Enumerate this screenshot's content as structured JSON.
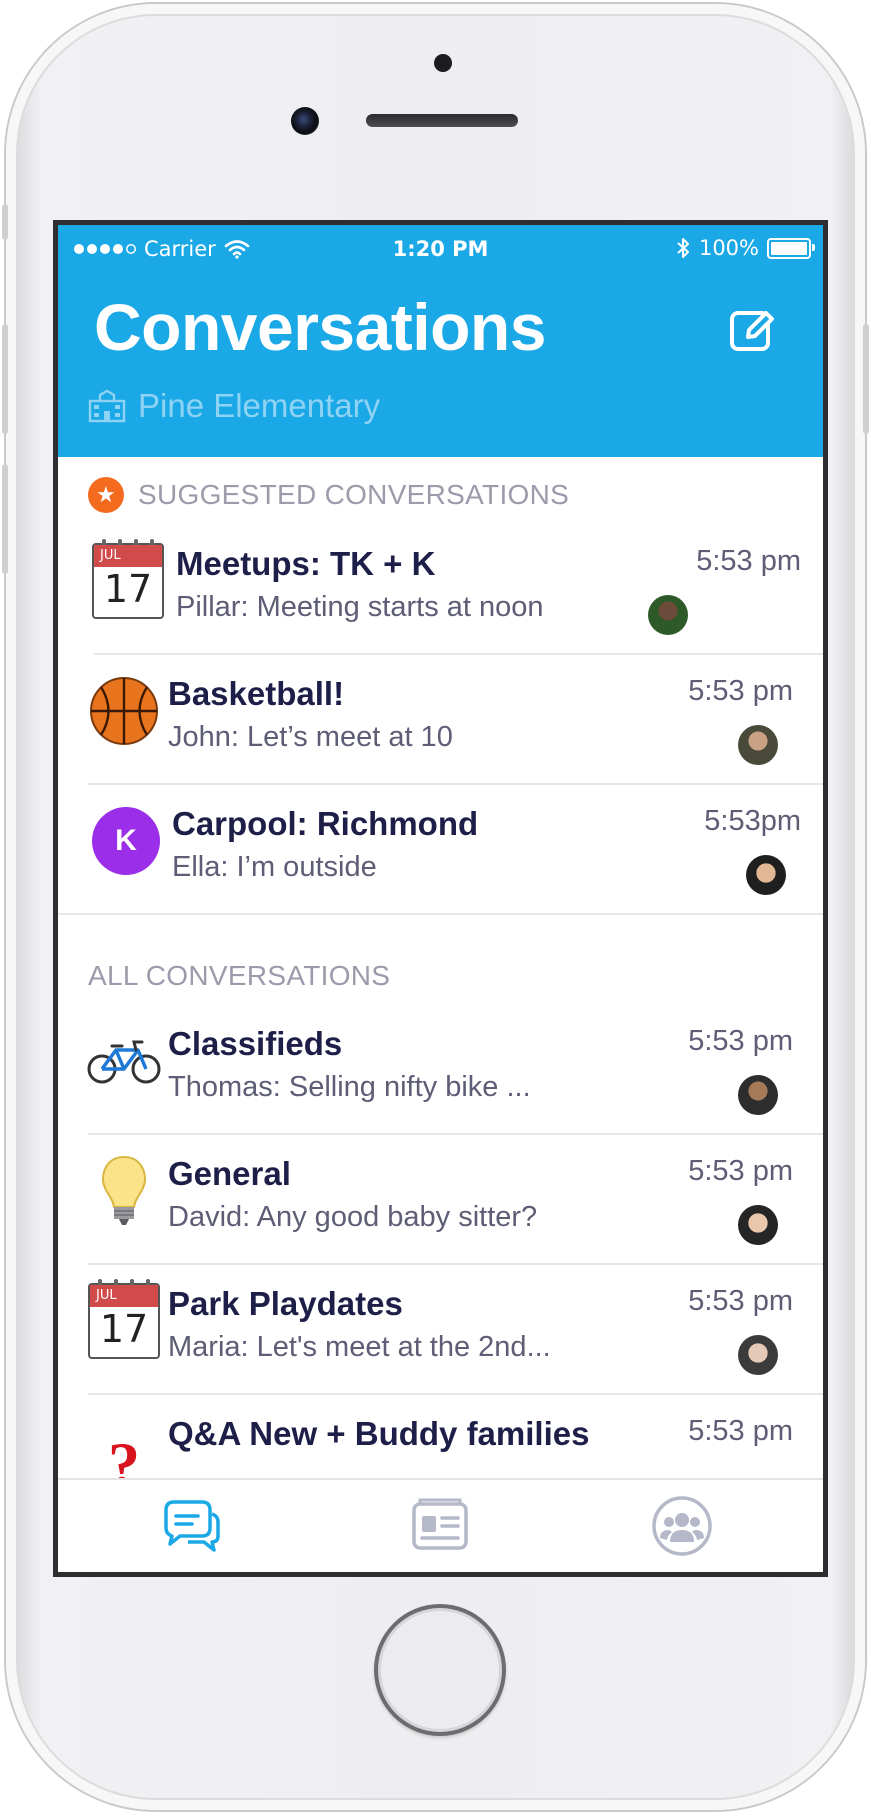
{
  "status_bar": {
    "carrier": "Carrier",
    "time": "1:20 PM",
    "battery": "100%"
  },
  "header": {
    "title": "Conversations",
    "school": "Pine Elementary",
    "colors": {
      "brand": "#1ba8e6",
      "school_text": "#8fd3f4"
    }
  },
  "suggested": {
    "heading": "SUGGESTED CONVERSATIONS",
    "items": [
      {
        "name": "Meetups: TK + K",
        "message": "Pillar: Meeting starts at noon",
        "time": "5:53 pm",
        "icon": "calendar-icon",
        "calendar_month": "JUL",
        "calendar_day": "17"
      },
      {
        "name": "Basketball!",
        "message": "John: Let’s meet at 10",
        "time": "5:53 pm",
        "icon": "basketball-icon"
      },
      {
        "name": "Carpool: Richmond",
        "message": "Ella: I’m outside",
        "time": "5:53pm",
        "icon": "letter-badge",
        "badge_letter": "K"
      }
    ]
  },
  "all": {
    "heading": "ALL CONVERSATIONS",
    "items": [
      {
        "name": "Classifieds",
        "message": "Thomas: Selling nifty bike ...",
        "time": "5:53 pm",
        "icon": "bicycle-icon"
      },
      {
        "name": "General",
        "message": "David: Any good baby sitter?",
        "time": "5:53 pm",
        "icon": "lightbulb-icon"
      },
      {
        "name": "Park Playdates",
        "message": "Maria: Let's meet at the 2nd...",
        "time": "5:53 pm",
        "icon": "calendar-icon",
        "calendar_month": "JUL",
        "calendar_day": "17"
      },
      {
        "name": "Q&A New + Buddy families",
        "message": "",
        "time": "5:53 pm",
        "icon": "question-mark-icon"
      }
    ]
  },
  "tabbar": {
    "tabs": [
      "conversations-tab",
      "directory-tab",
      "groups-tab"
    ],
    "active": "conversations-tab"
  }
}
